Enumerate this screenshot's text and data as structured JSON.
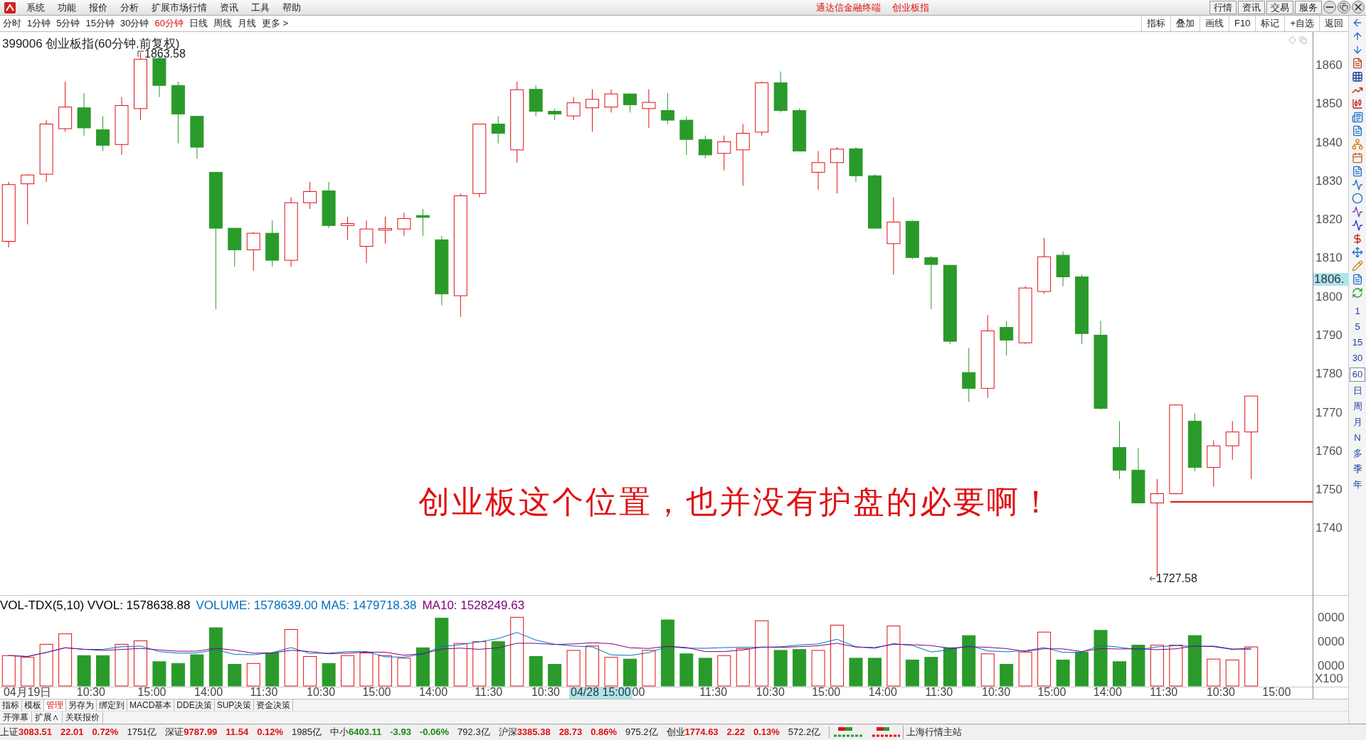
{
  "menu": {
    "items": [
      "系统",
      "功能",
      "报价",
      "分析",
      "扩展市场行情",
      "资讯",
      "工具",
      "帮助"
    ],
    "title": [
      "通达信金融终端",
      "创业板指"
    ],
    "buttons": [
      "行情",
      "资讯",
      "交易",
      "服务"
    ]
  },
  "period_bar": {
    "periods": [
      {
        "label": "分时",
        "selected": false
      },
      {
        "label": "1分钟",
        "selected": false
      },
      {
        "label": "5分钟",
        "selected": false
      },
      {
        "label": "15分钟",
        "selected": false
      },
      {
        "label": "30分钟",
        "selected": false
      },
      {
        "label": "60分钟",
        "selected": true
      },
      {
        "label": "日线",
        "selected": false
      },
      {
        "label": "周线",
        "selected": false
      },
      {
        "label": "月线",
        "selected": false
      },
      {
        "label": "更多 >",
        "selected": false
      }
    ],
    "tools": [
      "指标",
      "叠加",
      "画线",
      "F10",
      "标记",
      "+自选",
      "返回"
    ]
  },
  "chart": {
    "title": "399006 创业板指(60分钟.前复权)",
    "high_label": "1863.58",
    "low_label": "1727.58",
    "current_price": "1806.",
    "yticks": [
      "1860",
      "1850",
      "1840",
      "1830",
      "1820",
      "1810",
      "1800",
      "1790",
      "1780",
      "1770",
      "1760",
      "1750",
      "1740"
    ],
    "annotation": "创业板这个位置，也并没有护盘的必要啊！"
  },
  "volume": {
    "legend": [
      {
        "text": "VOL-TDX(5,10) VVOL: 1578638.88",
        "color": "#000000"
      },
      {
        "text": "VOLUME: 1578639.00 MA5: 1479718.38",
        "color": "#0070c0"
      },
      {
        "text": "MA10: 1528249.63",
        "color": "#800080"
      }
    ],
    "yticks": [
      "0000",
      "0000",
      "0000"
    ],
    "unit": "X100"
  },
  "x_axis": {
    "labels": [
      "04月19日",
      "10:30",
      "15:00",
      "14:00",
      "11:30",
      "10:30",
      "15:00",
      "14:00",
      "11:30",
      "10:30",
      "11:30",
      "10:30",
      "15:00",
      "14:00",
      "11:30",
      "10:30",
      "15:00",
      "14:00",
      "11:30",
      "10:30",
      "15:00"
    ],
    "cursor_label": "04/28 15:00",
    "cursor_tail": "00"
  },
  "bottom_tabs": [
    {
      "label": "指标",
      "selected": false
    },
    {
      "label": "模板",
      "selected": false
    },
    {
      "label": "管理",
      "selected": true
    },
    {
      "label": "另存为",
      "selected": false
    },
    {
      "label": "绑定到",
      "selected": false
    },
    {
      "label": "MACD基本",
      "selected": false
    },
    {
      "label": "DDE决策",
      "selected": false
    },
    {
      "label": "SUP决策",
      "selected": false
    },
    {
      "label": "资金决策",
      "selected": false
    }
  ],
  "bottom_tabs_2": [
    "开弹幕",
    "扩展∧",
    "关联报价"
  ],
  "right_toolbar": {
    "periods": [
      {
        "label": "1",
        "selected": false
      },
      {
        "label": "5",
        "selected": false
      },
      {
        "label": "15",
        "selected": false
      },
      {
        "label": "30",
        "selected": false
      },
      {
        "label": "60",
        "selected": true
      },
      {
        "label": "日",
        "selected": false
      },
      {
        "label": "周",
        "selected": false
      },
      {
        "label": "月",
        "selected": false
      },
      {
        "label": "N",
        "selected": false
      },
      {
        "label": "多",
        "selected": false
      },
      {
        "label": "季",
        "selected": false
      },
      {
        "label": "年",
        "selected": false
      }
    ]
  },
  "status_bar": {
    "indices": [
      {
        "name": "上证",
        "value": "3083.51",
        "change": "22.01",
        "percent": "0.72%",
        "amount": "1751亿",
        "rising": true
      },
      {
        "name": "深证",
        "value": "9787.99",
        "change": "11.54",
        "percent": "0.12%",
        "amount": "1985亿",
        "rising": true
      },
      {
        "name": "中小",
        "value": "6403.11",
        "change": "-3.93",
        "percent": "-0.06%",
        "amount": "792.3亿",
        "rising": false
      },
      {
        "name": "沪深",
        "value": "3385.38",
        "change": "28.73",
        "percent": "0.86%",
        "amount": "975.2亿",
        "rising": true
      },
      {
        "name": "创业",
        "value": "1774.63",
        "change": "2.22",
        "percent": "0.13%",
        "amount": "572.2亿",
        "rising": true
      }
    ],
    "server": "上海行情主站"
  }
}
